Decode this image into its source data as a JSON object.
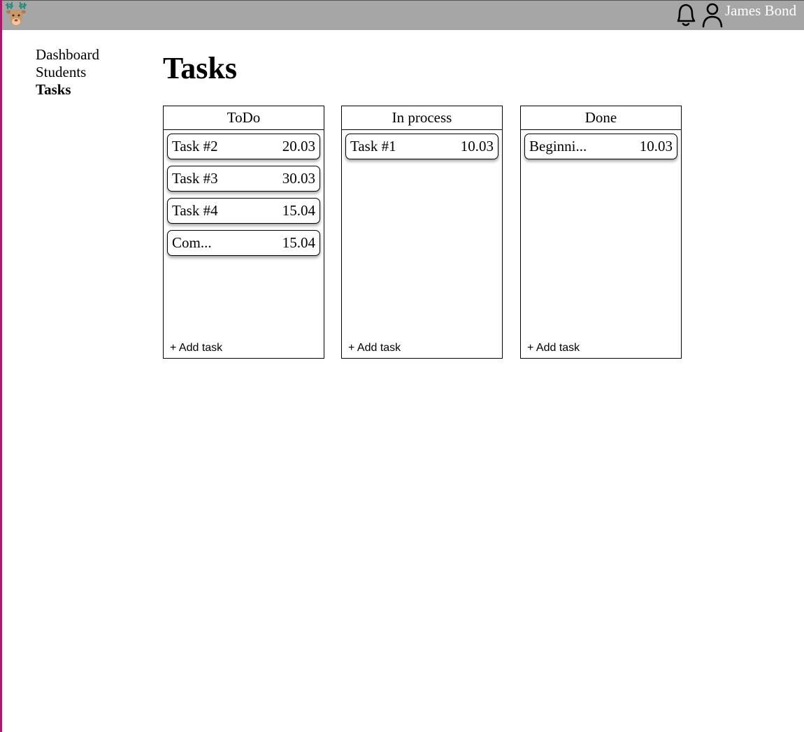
{
  "header": {
    "logo_icon": "deer-logo-icon",
    "notification_icon": "bell-icon",
    "profile_icon": "user-icon",
    "user_name": "James Bond",
    "background_color": "#a6a6a6"
  },
  "sidebar": {
    "items": [
      {
        "label": "Dashboard",
        "active": false
      },
      {
        "label": "Students",
        "active": false
      },
      {
        "label": "Tasks",
        "active": true
      }
    ]
  },
  "page": {
    "title": "Tasks"
  },
  "board": {
    "columns": [
      {
        "title": "ToDo",
        "add_label": "+ Add task",
        "cards": [
          {
            "title": "Task #2",
            "date": "20.03"
          },
          {
            "title": "Task #3",
            "date": "30.03"
          },
          {
            "title": "Task #4",
            "date": "15.04"
          },
          {
            "title": "Com...",
            "date": "15.04"
          }
        ]
      },
      {
        "title": "In process",
        "add_label": "+ Add task",
        "cards": [
          {
            "title": "Task #1",
            "date": "10.03"
          }
        ]
      },
      {
        "title": "Done",
        "add_label": "+ Add task",
        "cards": [
          {
            "title": "Beginni...",
            "date": "10.03"
          }
        ]
      }
    ]
  }
}
